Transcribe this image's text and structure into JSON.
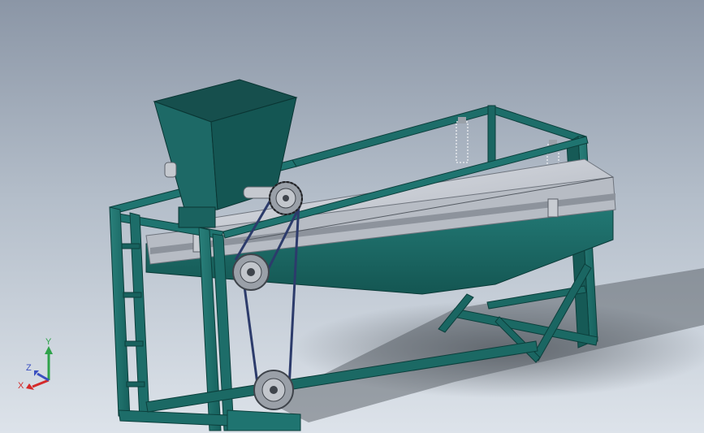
{
  "viewport": {
    "background_top": "#8b96a6",
    "background_bottom": "#dde3ea"
  },
  "model": {
    "frame_color": "#1f6f6b",
    "frame_dark": "#0f4a47",
    "hopper_color": "#1e6c69",
    "trough_color": "#1b6a68",
    "screen_color": "#c9ccd3",
    "belt_color": "#2c3b6b",
    "pulley_color": "#9aa0a8",
    "spring_color": "#d8dce2"
  },
  "triad": {
    "y_label": "Y",
    "z_label": "Z",
    "x_label": "X",
    "y_color": "#2ea24a",
    "x_color": "#d42a2a",
    "z_color": "#3a4fc0"
  }
}
